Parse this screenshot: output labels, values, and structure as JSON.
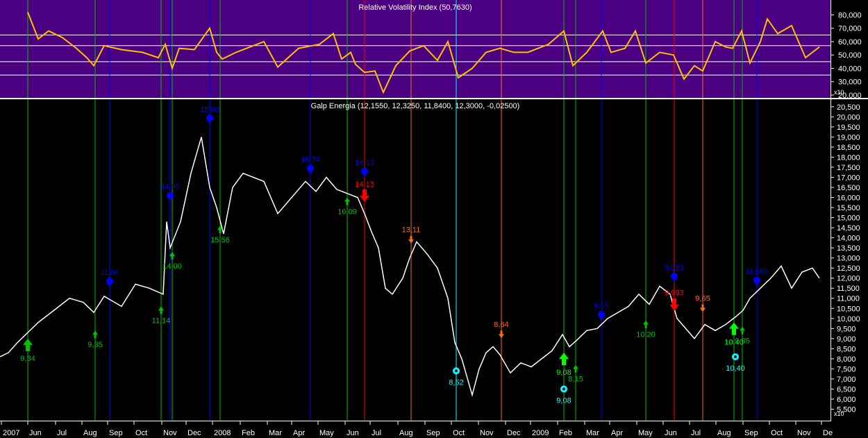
{
  "colors": {
    "background": "#000000",
    "rvi_panel_bg": "#4b0082",
    "rvi_line": "#ffc000",
    "price_line": "#ffffff",
    "green": "#00c000",
    "bright_green": "#00ff00",
    "blue": "#0000ff",
    "red": "#ff0000",
    "orange": "#ff6a20",
    "cyan": "#00ffff",
    "axis_text": "#ffffff"
  },
  "chart_data": [
    {
      "type": "line",
      "title": "Relative Volatility Index (50,7630)",
      "ylim": [
        20,
        87
      ],
      "y_ticks": [
        "80,000",
        "70,000",
        "60,000",
        "50,000",
        "40,000",
        "30,000",
        "20,000"
      ],
      "y_tick_values": [
        80,
        70,
        60,
        50,
        40,
        30,
        20
      ],
      "multiplier_label": "x10",
      "reference_lines": [
        35,
        45,
        57,
        65
      ],
      "x": [
        0,
        20,
        40,
        55,
        70,
        90,
        110,
        125,
        135,
        150,
        175,
        205,
        228,
        238,
        248,
        258,
        280,
        302,
        312,
        320,
        340,
        380,
        400,
        430,
        460,
        480,
        492,
        505,
        512,
        525,
        540,
        552,
        570,
        590,
        610,
        630,
        645,
        660,
        680,
        700,
        720,
        740,
        760,
        790,
        812,
        825,
        845,
        868,
        880,
        900,
        915,
        930,
        950,
        970,
        985,
        1000,
        1012,
        1030,
        1045,
        1055,
        1068,
        1080,
        1095,
        1105,
        1120,
        1140,
        1160,
        1180
      ],
      "series": [
        {
          "values": [
            null,
            null,
            82,
            62,
            68,
            63,
            55,
            48,
            42,
            57,
            54,
            52,
            48,
            58,
            40,
            55,
            54,
            70,
            52,
            47,
            52,
            60,
            41,
            55,
            58,
            66,
            47,
            52,
            43,
            37,
            38,
            22,
            42,
            53,
            57,
            46,
            60,
            33,
            40,
            52,
            55,
            52,
            52,
            58,
            68,
            42,
            52,
            68,
            52,
            55,
            68,
            44,
            52,
            50,
            32,
            42,
            38,
            60,
            56,
            55,
            68,
            44,
            60,
            77,
            66,
            72,
            48,
            56
          ]
        }
      ]
    },
    {
      "type": "line",
      "title": "Galp Energia (12,1550, 12,3250, 11,8400, 12,3000, -0,02500)",
      "ylim": [
        5.0,
        20.7
      ],
      "y_ticks": [
        "20,500",
        "20,000",
        "19,500",
        "19,000",
        "18,500",
        "18,000",
        "17,500",
        "17,000",
        "16,500",
        "16,000",
        "15,500",
        "15,000",
        "14,500",
        "14,000",
        "13,500",
        "13,000",
        "12,500",
        "12,000",
        "11,500",
        "11,000",
        "10,500",
        "10,000",
        "9,500",
        "9,000",
        "8,500",
        "8,000",
        "7,500",
        "7,000",
        "6,500",
        "6,000",
        "5,500"
      ],
      "y_tick_values": [
        20.5,
        20.0,
        19.5,
        19.0,
        18.5,
        18.0,
        17.5,
        17.0,
        16.5,
        16.0,
        15.5,
        15.0,
        14.5,
        14.0,
        13.5,
        13.0,
        12.5,
        12.0,
        11.5,
        11.0,
        10.5,
        10.0,
        9.5,
        9.0,
        8.5,
        8.0,
        7.5,
        7.0,
        6.5,
        6.0,
        5.5
      ],
      "multiplier_label": "x10",
      "x_ticks": [
        "2007",
        "Jun",
        "Jul",
        "Aug",
        "Sep",
        "Oct",
        "Nov",
        "Dec",
        "2008",
        "Feb",
        "Mar",
        "Apr",
        "May",
        "Jun",
        "Jul",
        "Aug",
        "Sep",
        "Oct",
        "Nov",
        "Dec",
        "2009",
        "Feb",
        "Mar",
        "Apr",
        "May",
        "Jun",
        "Jul",
        "Aug",
        "Sep",
        "Oct",
        "Nov",
        "De"
      ],
      "x_tick_values": [
        2,
        40,
        80,
        118,
        155,
        193,
        233,
        268,
        306,
        346,
        385,
        420,
        458,
        497,
        533,
        573,
        612,
        650,
        689,
        728,
        764,
        803,
        842,
        878,
        917,
        955,
        993,
        1031,
        1070,
        1108,
        1146,
        1183
      ],
      "x": [
        0,
        12,
        25,
        40,
        55,
        70,
        85,
        100,
        120,
        135,
        150,
        160,
        175,
        195,
        215,
        235,
        240,
        245,
        260,
        275,
        290,
        302,
        312,
        322,
        335,
        350,
        365,
        380,
        400,
        420,
        440,
        455,
        470,
        485,
        500,
        515,
        525,
        535,
        545,
        555,
        565,
        580,
        590,
        600,
        615,
        630,
        645,
        655,
        665,
        680,
        690,
        700,
        710,
        720,
        735,
        750,
        765,
        780,
        795,
        810,
        820,
        830,
        845,
        860,
        875,
        890,
        905,
        920,
        935,
        950,
        965,
        975,
        985,
        1000,
        1015,
        1030,
        1045,
        1060,
        1070,
        1080,
        1095,
        1110,
        1125,
        1140,
        1155,
        1170,
        1180
      ],
      "series": [
        {
          "values": [
            8.1,
            8.3,
            8.8,
            9.3,
            9.8,
            10.2,
            10.6,
            11.0,
            10.8,
            10.3,
            11.1,
            10.9,
            10.6,
            11.7,
            11.5,
            11.2,
            14.8,
            13.5,
            14.8,
            17.2,
            19.0,
            16.5,
            15.5,
            14.2,
            16.5,
            17.2,
            17.0,
            16.8,
            15.2,
            16.0,
            16.8,
            16.3,
            17.0,
            16.4,
            16.2,
            16.0,
            15.2,
            14.3,
            13.5,
            11.5,
            11.2,
            12.0,
            13.0,
            13.8,
            13.2,
            12.5,
            11.0,
            8.8,
            8.0,
            6.2,
            7.5,
            8.3,
            8.6,
            8.2,
            7.3,
            7.8,
            7.6,
            8.0,
            8.4,
            9.2,
            8.6,
            8.9,
            9.4,
            9.5,
            10.0,
            10.3,
            10.6,
            11.2,
            10.7,
            11.6,
            11.2,
            10.0,
            9.6,
            9.0,
            9.7,
            9.4,
            9.7,
            10.1,
            10.4,
            11.0,
            11.5,
            12.0,
            12.6,
            11.5,
            12.3,
            12.5,
            12.0
          ]
        }
      ],
      "annotations": [
        {
          "text": "9,34",
          "x": 40,
          "y": 9.0,
          "color": "green",
          "marker": "big-up-arrow",
          "label_pos": "below"
        },
        {
          "text": "9,35",
          "x": 137,
          "y": 9.4,
          "color": "green",
          "marker": "up-arrow",
          "label_pos": "below"
        },
        {
          "text": "11,04",
          "x": 158,
          "y": 11.85,
          "color": "blue",
          "marker": "diamond",
          "label_pos": "above"
        },
        {
          "text": "11,14",
          "x": 232,
          "y": 10.6,
          "color": "green",
          "marker": "up-arrow",
          "label_pos": "below"
        },
        {
          "text": "14,95",
          "x": 245,
          "y": 16.1,
          "color": "blue",
          "marker": "diamond",
          "label_pos": "above"
        },
        {
          "text": "14,00",
          "x": 248,
          "y": 13.3,
          "color": "green",
          "marker": "up-arrow",
          "label_pos": "below"
        },
        {
          "text": "19,03",
          "x": 302,
          "y": 19.95,
          "color": "blue",
          "marker": "diamond",
          "label_pos": "above"
        },
        {
          "text": "15,56",
          "x": 317,
          "y": 14.6,
          "color": "green",
          "marker": "up-arrow",
          "label_pos": "below"
        },
        {
          "text": "16,74",
          "x": 447,
          "y": 17.45,
          "color": "blue",
          "marker": "diamond",
          "label_pos": "above"
        },
        {
          "text": "16,09",
          "x": 500,
          "y": 16.0,
          "color": "green",
          "marker": "up-arrow",
          "label_pos": "below"
        },
        {
          "text": "14,13",
          "x": 525,
          "y": 17.3,
          "color": "blue",
          "marker": "diamond",
          "label_pos": "above"
        },
        {
          "text": "14,13",
          "x": 525,
          "y": 16.4,
          "color": "red",
          "marker": "big-down-arrow",
          "label_pos": "above"
        },
        {
          "text": "13,11",
          "x": 592,
          "y": 14.1,
          "color": "orange",
          "marker": "down-arrow",
          "label_pos": "above"
        },
        {
          "text": "8,52",
          "x": 657,
          "y": 7.4,
          "color": "cyan",
          "marker": "skull",
          "label_pos": "below"
        },
        {
          "text": "8,64",
          "x": 722,
          "y": 9.4,
          "color": "orange",
          "marker": "down-arrow",
          "label_pos": "above"
        },
        {
          "text": "9,08",
          "x": 812,
          "y": 8.3,
          "color": "bright_green",
          "marker": "big-up-arrow",
          "label_pos": "below"
        },
        {
          "text": "9,08",
          "x": 812,
          "y": 6.5,
          "color": "cyan",
          "marker": "skull",
          "label_pos": "below"
        },
        {
          "text": "8,15",
          "x": 829,
          "y": 7.7,
          "color": "green",
          "marker": "up-arrow",
          "label_pos": "below"
        },
        {
          "text": "9,65",
          "x": 866,
          "y": 10.2,
          "color": "blue",
          "marker": "diamond",
          "label_pos": "above"
        },
        {
          "text": "10,20",
          "x": 930,
          "y": 9.9,
          "color": "green",
          "marker": "up-arrow",
          "label_pos": "below"
        },
        {
          "text": "9,993",
          "x": 971,
          "y": 12.1,
          "color": "blue",
          "marker": "diamond",
          "label_pos": "above"
        },
        {
          "text": "9,993",
          "x": 971,
          "y": 11.0,
          "color": "red",
          "marker": "big-down-arrow",
          "label_pos": "above"
        },
        {
          "text": "9,65",
          "x": 1012,
          "y": 10.7,
          "color": "orange",
          "marker": "down-arrow",
          "label_pos": "above"
        },
        {
          "text": "10,40",
          "x": 1057,
          "y": 9.8,
          "color": "bright_green",
          "marker": "big-up-arrow",
          "label_pos": "below"
        },
        {
          "text": "10,40",
          "x": 1059,
          "y": 8.1,
          "color": "cyan",
          "marker": "skull",
          "label_pos": "below"
        },
        {
          "text": "9,35",
          "x": 1069,
          "y": 9.6,
          "color": "green",
          "marker": "up-arrow",
          "label_pos": "below"
        },
        {
          "text": "11,085",
          "x": 1090,
          "y": 11.9,
          "color": "blue",
          "marker": "diamond",
          "label_pos": "above"
        }
      ],
      "vertical_lines": [
        {
          "x": 40,
          "color": "green"
        },
        {
          "x": 137,
          "color": "green"
        },
        {
          "x": 158,
          "color": "blue"
        },
        {
          "x": 232,
          "color": "green"
        },
        {
          "x": 245,
          "color": "blue"
        },
        {
          "x": 248,
          "color": "green"
        },
        {
          "x": 302,
          "color": "blue"
        },
        {
          "x": 317,
          "color": "green"
        },
        {
          "x": 447,
          "color": "blue"
        },
        {
          "x": 500,
          "color": "green"
        },
        {
          "x": 525,
          "color": "red"
        },
        {
          "x": 592,
          "color": "orange"
        },
        {
          "x": 657,
          "color": "cyan"
        },
        {
          "x": 722,
          "color": "orange"
        },
        {
          "x": 812,
          "color": "green"
        },
        {
          "x": 829,
          "color": "green"
        },
        {
          "x": 866,
          "color": "blue"
        },
        {
          "x": 930,
          "color": "green"
        },
        {
          "x": 971,
          "color": "red"
        },
        {
          "x": 1012,
          "color": "orange"
        },
        {
          "x": 1057,
          "color": "green"
        },
        {
          "x": 1069,
          "color": "green"
        },
        {
          "x": 1090,
          "color": "blue"
        }
      ]
    }
  ]
}
